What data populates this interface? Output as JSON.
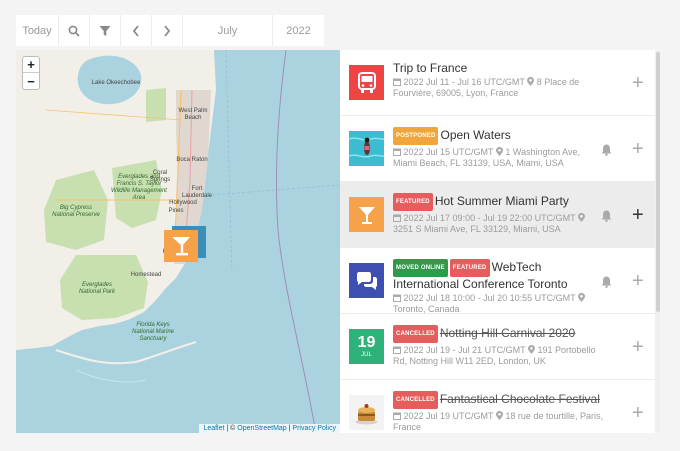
{
  "toolbar": {
    "today_label": "Today",
    "month": "July",
    "year": "2022"
  },
  "map": {
    "zoom_in": "+",
    "zoom_out": "−",
    "attribution": {
      "leaflet": "Leaflet",
      "sep1": " | © ",
      "osm": "OpenStreetMap",
      "sep2": " | ",
      "privacy": "Privacy Policy"
    },
    "labels": {
      "okeechobee": "Lake Okeechobee",
      "west_palm": "West Palm Beach",
      "boca": "Boca Raton",
      "coral": "Coral Springs",
      "everglades_francis": "Everglades and Francis S. Taylor Wildlife Management Area",
      "big_cypress": "Big Cypress National Preserve",
      "ftl": "Fort Lauderdale",
      "hollywood": "Hollywood",
      "pines": "Pines",
      "homestead": "Homestead",
      "everglades_np": "Everglades National Park",
      "fl_keys": "Florida Keys National Marine Sanctuary",
      "kendall": "Kei"
    },
    "colors": {
      "water": "#aad3df",
      "land": "#f2efe9",
      "park": "#c8dfb0",
      "urban": "#e0d8d0",
      "marker": "#f6a24b"
    }
  },
  "events": [
    {
      "title": "Trip to France",
      "badges": [],
      "cancelled": false,
      "when": "2022 Jul 11 - Jul 16 UTC/GMT",
      "where": "8 Place de Fourvière, 69005, Lyon, France",
      "thumb": "bus-icon",
      "thumb_color": "#ef4444",
      "has_bell": false,
      "highlight": false
    },
    {
      "title": "Open Waters",
      "badges": [
        "Postponed"
      ],
      "cancelled": false,
      "when": "2022 Jul 15 UTC/GMT",
      "where": "1 Washington Ave, Miami Beach, FL 33139, USA, Miami, USA",
      "thumb": "pool-photo",
      "thumb_color": "#3bbcd0",
      "has_bell": true,
      "highlight": false
    },
    {
      "title": "Hot Summer Miami Party",
      "badges": [
        "Featured"
      ],
      "cancelled": false,
      "when": "2022 Jul 17 09:00 - Jul 19 22:00 UTC/GMT",
      "where": "3251 S Miami Ave, FL 33129, Miami, USA",
      "thumb": "cocktail-icon",
      "thumb_color": "#f6a24b",
      "has_bell": true,
      "highlight": true
    },
    {
      "title": "WebTech International Conference Toronto",
      "badges": [
        "Moved Online",
        "Featured"
      ],
      "cancelled": false,
      "when": "2022 Jul 18 10:00 - Jul 20 10:55 UTC/GMT",
      "where": "Toronto, Canada",
      "thumb": "chat-icon",
      "thumb_color": "#3d4fb0",
      "has_bell": true,
      "highlight": false
    },
    {
      "title": "Notting Hill Carnival 2020",
      "badges": [
        "Cancelled"
      ],
      "cancelled": true,
      "when": "2022 Jul 19 - Jul 21 UTC/GMT",
      "where": "191 Portobello Rd, Notting Hill W11 2ED, London, UK",
      "thumb": "date-tile",
      "thumb_color": "#2fb17a",
      "date_day": "19",
      "date_month": "Jul",
      "has_bell": false,
      "highlight": false
    },
    {
      "title": "Fantastical Chocolate Festival",
      "badges": [
        "Cancelled"
      ],
      "cancelled": true,
      "when": "2022 Jul 19 UTC/GMT",
      "where": "18 rue de tourtille, Paris, France",
      "thumb": "cake-photo",
      "thumb_color": "#f3f3f3",
      "has_bell": false,
      "highlight": false
    }
  ],
  "plus_label": "+"
}
